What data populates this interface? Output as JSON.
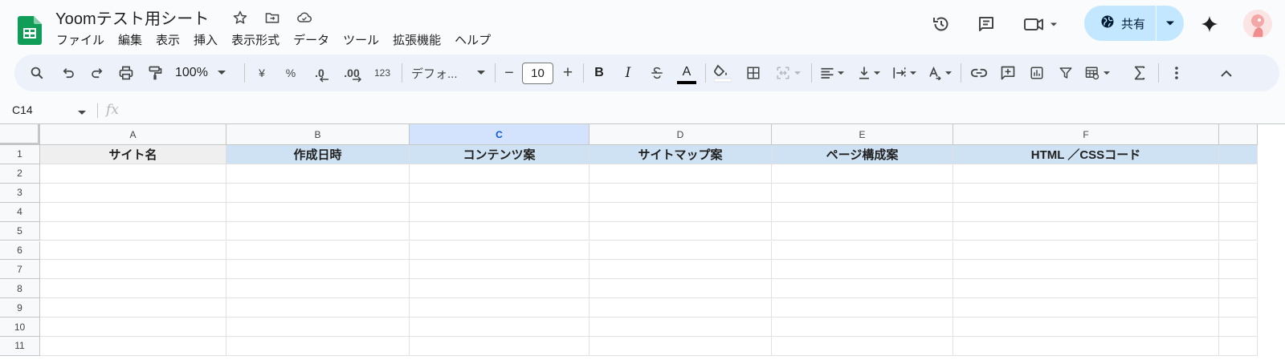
{
  "app": {
    "doc_title": "Yoomテスト用シート",
    "icons": [
      "star-icon",
      "move-to-folder-icon",
      "cloud-saved-icon"
    ]
  },
  "menu": [
    "ファイル",
    "編集",
    "表示",
    "挿入",
    "表示形式",
    "データ",
    "ツール",
    "拡張機能",
    "ヘルプ"
  ],
  "header_right": {
    "share_label": "共有",
    "icons": [
      "version-history-icon",
      "comments-icon",
      "meet-icon",
      "gemini-icon"
    ]
  },
  "toolbar": {
    "zoom": "100%",
    "currency": "¥",
    "percent": "%",
    "decrease_decimal": ".0",
    "increase_decimal": ".00",
    "number_format": "123",
    "font": "デフォ...",
    "font_size": "10",
    "minus": "−",
    "plus": "+",
    "bold": "B",
    "italic": "I",
    "text_color_letter": "A",
    "text_color": "#000000"
  },
  "formula_bar": {
    "name_box": "C14",
    "fx": "fx",
    "value": ""
  },
  "sheet": {
    "columns": [
      "A",
      "B",
      "C",
      "D",
      "E",
      "F"
    ],
    "selected_column": "C",
    "rows": [
      "1",
      "2",
      "3",
      "4",
      "5",
      "6",
      "7",
      "8",
      "9",
      "10",
      "11"
    ],
    "header_row": [
      "サイト名",
      "作成日時",
      "コンテンツ案",
      "サイトマップ案",
      "ページ構成案",
      "HTML ／CSSコード"
    ],
    "header_fills": [
      "#efefef",
      "#cfe2f3",
      "#cfe2f3",
      "#cfe2f3",
      "#cfe2f3",
      "#cfe2f3"
    ]
  },
  "colors": {
    "accent": "#0b57d0",
    "share_bg": "#c2e7ff",
    "selected_col": "#d3e3fd",
    "toolbar_bg": "#edf2fa"
  }
}
